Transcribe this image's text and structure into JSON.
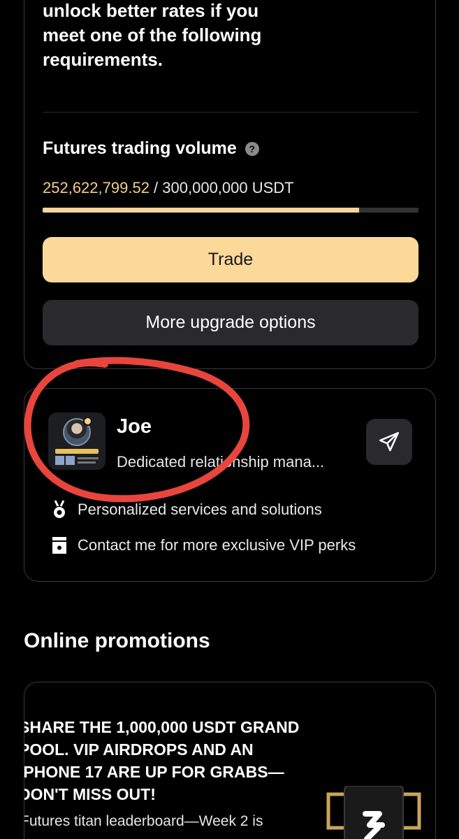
{
  "upgrade": {
    "intro": "unlock better rates if you meet one of the following requirements.",
    "requirement_title": "Futures trading volume",
    "current_volume": "252,622,799.52",
    "separator": " / ",
    "target_volume": "300,000,000 USDT",
    "progress_fraction": 0.842,
    "trade_label": "Trade",
    "more_options_label": "More upgrade options"
  },
  "manager": {
    "name": "Joe",
    "role": "Dedicated relationship mana...",
    "perks": [
      {
        "icon": "medal-icon",
        "text": "Personalized services and solutions"
      },
      {
        "icon": "gift-card-icon",
        "text": "Contact me for more exclusive VIP perks"
      }
    ]
  },
  "promotions": {
    "section_title": "Online promotions",
    "headline": "SHARE THE 1,000,000 USDT GRAND POOL. VIP AIRDROPS AND AN IPHONE 17 ARE UP FOR GRABS—DON'T MISS OUT!",
    "subtitle": "Futures titan leaderboard—Week 2 is"
  },
  "colors": {
    "background": "#000000",
    "accent": "#fbd999",
    "volume_highlight": "#f3cd8c",
    "annotation": "#e8453c"
  }
}
